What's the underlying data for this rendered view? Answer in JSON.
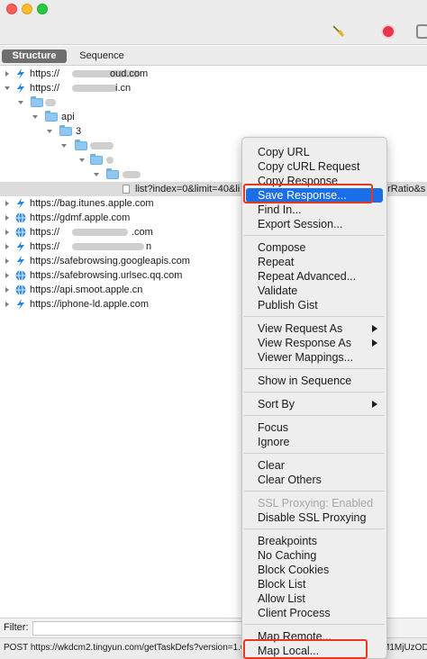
{
  "tabs": {
    "structure": "Structure",
    "sequence": "Sequence"
  },
  "tree": {
    "hosts_top": [
      {
        "label": "https://",
        "suffix": "oud.com",
        "icon": "lightning-icon"
      },
      {
        "label": "https://",
        "suffix": "i.cn",
        "icon": "lightning-icon"
      }
    ],
    "folder_api": "api",
    "folder_3": "3",
    "selected_path": "list?index=0&limit=40&li",
    "hosts_bottom": [
      {
        "label": "https://bag.itunes.apple.com",
        "icon": "lightning-icon"
      },
      {
        "label": "https://gdmf.apple.com",
        "icon": "globe-icon"
      },
      {
        "label": "https://",
        "suffix": ".com",
        "icon": "globe-icon"
      },
      {
        "label": "https://",
        "suffix": "n",
        "icon": "lightning-icon"
      },
      {
        "label": "https://safebrowsing.googleapis.com",
        "icon": "lightning-icon"
      },
      {
        "label": "https://safebrowsing.urlsec.qq.com",
        "icon": "globe-icon"
      },
      {
        "label": "https://api.smoot.apple.cn",
        "icon": "globe-icon"
      },
      {
        "label": "https://iphone-ld.apple.com",
        "icon": "lightning-icon"
      }
    ],
    "right_cut_text": "erRatio&s"
  },
  "menu": {
    "items": [
      "Copy URL",
      "Copy cURL Request",
      "Copy Response",
      "Save Response...",
      "Find In...",
      "Export Session...",
      "Compose",
      "Repeat",
      "Repeat Advanced...",
      "Validate",
      "Publish Gist",
      "View Request As",
      "View Response As",
      "Viewer Mappings...",
      "Show in Sequence",
      "Sort By",
      "Focus",
      "Ignore",
      "Clear",
      "Clear Others",
      "SSL Proxying: Enabled",
      "Disable SSL Proxying",
      "Breakpoints",
      "No Caching",
      "Block Cookies",
      "Block List",
      "Allow List",
      "Client Process",
      "Map Remote...",
      "Map Local..."
    ]
  },
  "filter": {
    "label": "Filter:",
    "value": ""
  },
  "status": {
    "text": "POST https://wkdcm2.tingyun.com/getTaskDefs?version=1.0",
    "right": "M1MjUzOD"
  },
  "colors": {
    "highlight": "#1a6fe8",
    "callout": "#e8391f",
    "selected_row": "#dcdcdc"
  }
}
